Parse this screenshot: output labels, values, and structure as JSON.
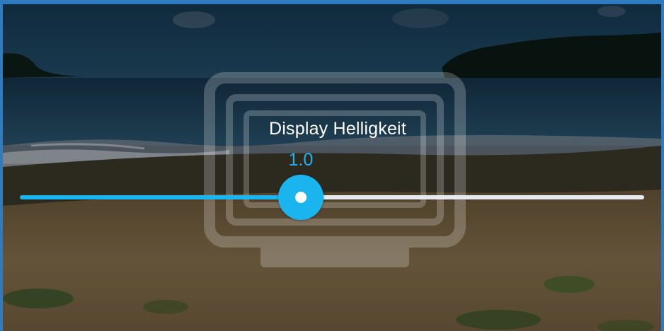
{
  "overlay": {
    "title": "Display Helligkeit",
    "icon": "monitor-icon"
  },
  "brightness": {
    "value_label": "1.0",
    "level": 0.45
  },
  "colors": {
    "accent": "#1ab5ef",
    "track_inactive": "#e6e8f2",
    "frame": "#2e7bbf"
  }
}
